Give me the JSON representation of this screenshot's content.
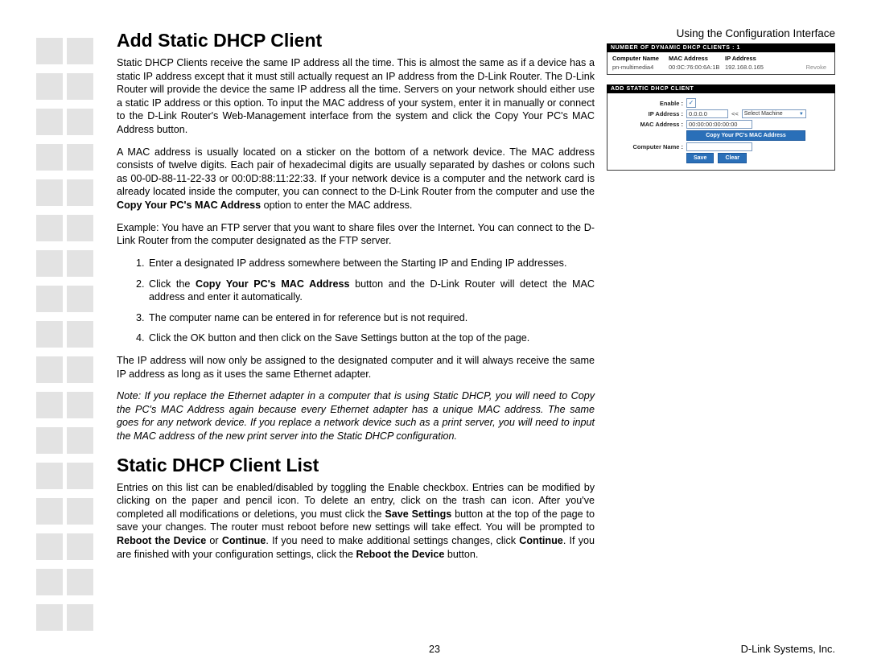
{
  "header": {
    "right": "Using the Configuration Interface"
  },
  "sections": {
    "s1_title": "Add Static DHCP Client",
    "s1_p1": "Static DHCP Clients receive the same IP address all the time. This is almost the same as if a device has a static IP address except that it must still actually request an IP address from the D-Link Router. The D-Link Router will provide the device the same IP address all the time. Servers on your network should either use a static IP address or this option. To input the MAC address of your system, enter it in manually or connect to the D-Link Router's Web-Management interface from the system and click the Copy Your PC's MAC Address button.",
    "s1_p2a": "A MAC address is usually located on a sticker on the bottom of a network device. The MAC address consists of twelve digits. Each pair of hexadecimal digits are usually separated by dashes or colons such as 00-0D-88-11-22-33 or 00:0D:88:11:22:33. If your network device is a computer and the network card is already located inside the computer, you can connect to the D-Link Router from the computer and use the ",
    "s1_p2_bold": "Copy Your PC's MAC Address",
    "s1_p2b": " option to enter the MAC address.",
    "s1_p3": "Example: You have an FTP server that you want to share files over the Internet. You can connect to the D-Link Router from the computer designated as the FTP server.",
    "ol": {
      "li1": "Enter a designated IP address somewhere between the Starting IP and Ending IP addresses.",
      "li2a": "Click the ",
      "li2_bold": "Copy Your PC's MAC Address",
      "li2b": " button and the D-Link Router will detect the MAC address and enter it automatically.",
      "li3": "The computer name can be entered in for reference but is not required.",
      "li4": "Click the OK button and then click on the Save Settings button at the top of the page."
    },
    "s1_p4": "The IP address will now only be assigned to the designated computer and it will always receive the same IP address as long as it uses the same Ethernet adapter.",
    "s1_note": "Note: If you replace the Ethernet adapter in a computer that is using Static DHCP, you will need to Copy the PC's MAC Address again because every Ethernet adapter has a unique MAC address. The same goes for any network device. If you replace a network device such as a print server, you will need to input the MAC address of the new print server into the Static DHCP configuration.",
    "s2_title": "Static DHCP Client List",
    "s2_p1a": "Entries on this list can be enabled/disabled by toggling the Enable checkbox. Entries can be modified by clicking on the paper and pencil icon. To delete an entry, click on the trash can icon. After you've completed all modifications or deletions, you must click the ",
    "s2_p1_bold1": "Save Settings",
    "s2_p1b": " button at the top of the page to save your changes. The router must reboot before new settings will take effect. You will be prompted to ",
    "s2_p1_bold2": "Reboot the Device",
    "s2_p1c": " or ",
    "s2_p1_bold3": "Continue",
    "s2_p1d": ". If you need to make additional settings changes, click ",
    "s2_p1_bold4": "Continue",
    "s2_p1e": ". If you are finished with your configuration settings, click the ",
    "s2_p1_bold5": "Reboot the Device",
    "s2_p1f": " button."
  },
  "figure": {
    "bar1": "NUMBER OF DYNAMIC DHCP CLIENTS : 1",
    "th_cn": "Computer Name",
    "th_mac": "MAC Address",
    "th_ip": "IP Address",
    "row_cn": "pn-multimedia4",
    "row_mac": "00:0C:76:00:6A:1B",
    "row_ip": "192.168.0.165",
    "revoke": "Revoke",
    "bar2": "ADD STATIC DHCP CLIENT",
    "lbl_enable": "Enable :",
    "lbl_ip": "IP Address :",
    "val_ip": "0.0.0.0",
    "lt": "<<",
    "select_label": "Select Machine",
    "lbl_mac": "MAC Address :",
    "val_mac": "00:00:00:00:00:00",
    "btn_copy": "Copy Your PC's MAC Address",
    "lbl_cn": "Computer Name :",
    "btn_save": "Save",
    "btn_clear": "Clear"
  },
  "footer": {
    "page": "23",
    "company": "D-Link Systems, Inc."
  }
}
